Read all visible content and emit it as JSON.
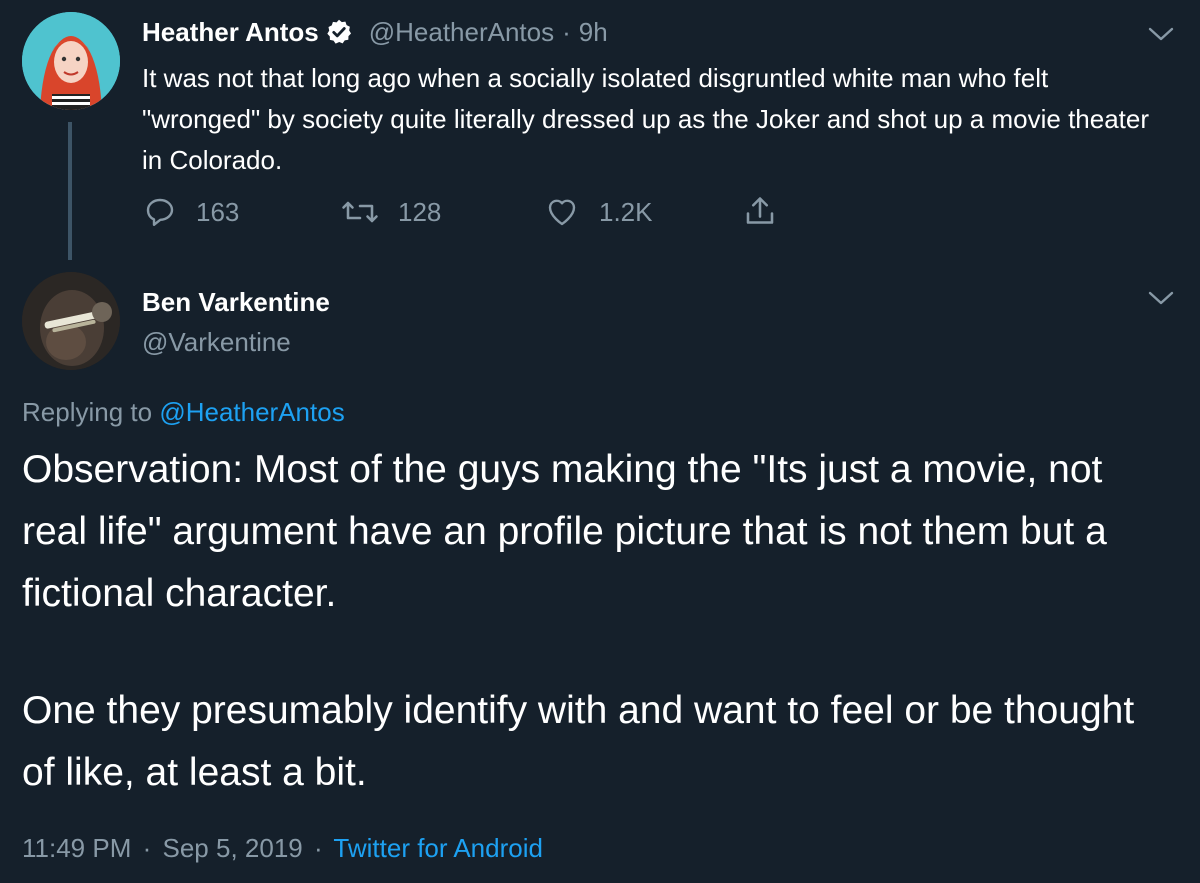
{
  "tweet1": {
    "author_name": "Heather Antos",
    "handle": "@HeatherAntos",
    "separator": "·",
    "time": "9h",
    "text": "It was not that long ago when a socially isolated disgruntled white man who felt \"wronged\" by society quite literally dressed up as the Joker and shot up a movie theater in Colorado.",
    "replies": "163",
    "retweets": "128",
    "likes": "1.2K",
    "verified_icon": "verified-badge-icon",
    "menu_icon": "chevron-down-icon"
  },
  "tweet2": {
    "author_name": "Ben Varkentine",
    "handle": "@Varkentine",
    "replying_label": "Replying to",
    "replying_to": "@HeatherAntos",
    "body_p1": "Observation:  Most of the guys making the \"Its just a movie, not real life\" argument have an profile picture that is not them but a fictional character.",
    "body_p2": "One they presumably identify with and want to feel or be thought of like, at least a bit.",
    "time": "11:49 PM",
    "date": "Sep 5, 2019",
    "dot1": "·",
    "dot2": "·",
    "source": "Twitter for Android",
    "menu_icon": "chevron-down-icon"
  },
  "colors": {
    "background": "#15202b",
    "muted": "#8899a6",
    "link": "#1da1f2",
    "verified": "#ffffff"
  }
}
